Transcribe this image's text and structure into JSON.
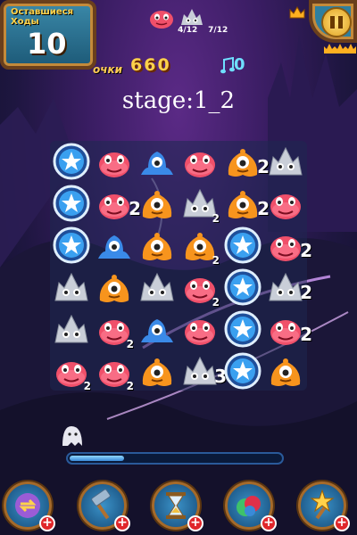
{
  "hud": {
    "moves_label": "Оставшиеся Ходы",
    "moves_value": "10",
    "score_label": "очки",
    "score_value": "660",
    "music_count": "0",
    "stage_text": "stage:1_2"
  },
  "goals": [
    {
      "monster": "red-blob-monster",
      "count": "4/12"
    },
    {
      "monster": "grey-spiky-monster",
      "count": "7/12"
    }
  ],
  "board": {
    "rows": [
      [
        {
          "piece": "star-orb"
        },
        {
          "piece": "red-blob"
        },
        {
          "piece": "blue-slime"
        },
        {
          "piece": "red-blob"
        },
        {
          "piece": "orange-monster",
          "count": "2",
          "big": true
        },
        {
          "piece": "grey-spiky"
        }
      ],
      [
        {
          "piece": "star-orb"
        },
        {
          "piece": "red-blob",
          "count": "2",
          "big": true
        },
        {
          "piece": "orange-monster"
        },
        {
          "piece": "grey-spiky",
          "count": "2"
        },
        {
          "piece": "orange-monster",
          "count": "2",
          "big": true
        },
        {
          "piece": "red-blob"
        }
      ],
      [
        {
          "piece": "star-orb"
        },
        {
          "piece": "blue-slime"
        },
        {
          "piece": "orange-monster"
        },
        {
          "piece": "orange-monster",
          "count": "2"
        },
        {
          "piece": "star-orb"
        },
        {
          "piece": "red-blob",
          "count": "2",
          "big": true
        }
      ],
      [
        {
          "piece": "grey-spiky"
        },
        {
          "piece": "orange-monster"
        },
        {
          "piece": "grey-spiky"
        },
        {
          "piece": "red-blob",
          "count": "2"
        },
        {
          "piece": "star-orb"
        },
        {
          "piece": "grey-spiky",
          "count": "2",
          "big": true
        }
      ],
      [
        {
          "piece": "grey-spiky"
        },
        {
          "piece": "red-blob",
          "count": "2"
        },
        {
          "piece": "blue-slime"
        },
        {
          "piece": "red-blob"
        },
        {
          "piece": "star-orb"
        },
        {
          "piece": "red-blob",
          "count": "2",
          "big": true
        }
      ],
      [
        {
          "piece": "red-blob",
          "count": "2"
        },
        {
          "piece": "red-blob",
          "count": "2"
        },
        {
          "piece": "orange-monster"
        },
        {
          "piece": "grey-spiky",
          "count": "3",
          "big": true
        },
        {
          "piece": "star-orb"
        },
        {
          "piece": "orange-monster"
        }
      ]
    ]
  },
  "progress": 0.26,
  "boosters": [
    "swap-booster",
    "hammer-booster",
    "hourglass-booster",
    "color-bomb-booster",
    "star-wand-booster"
  ],
  "colors": {
    "accent": "#ffd24a",
    "booster_plus": "#e0262a",
    "frame": "#6a3f1c"
  }
}
